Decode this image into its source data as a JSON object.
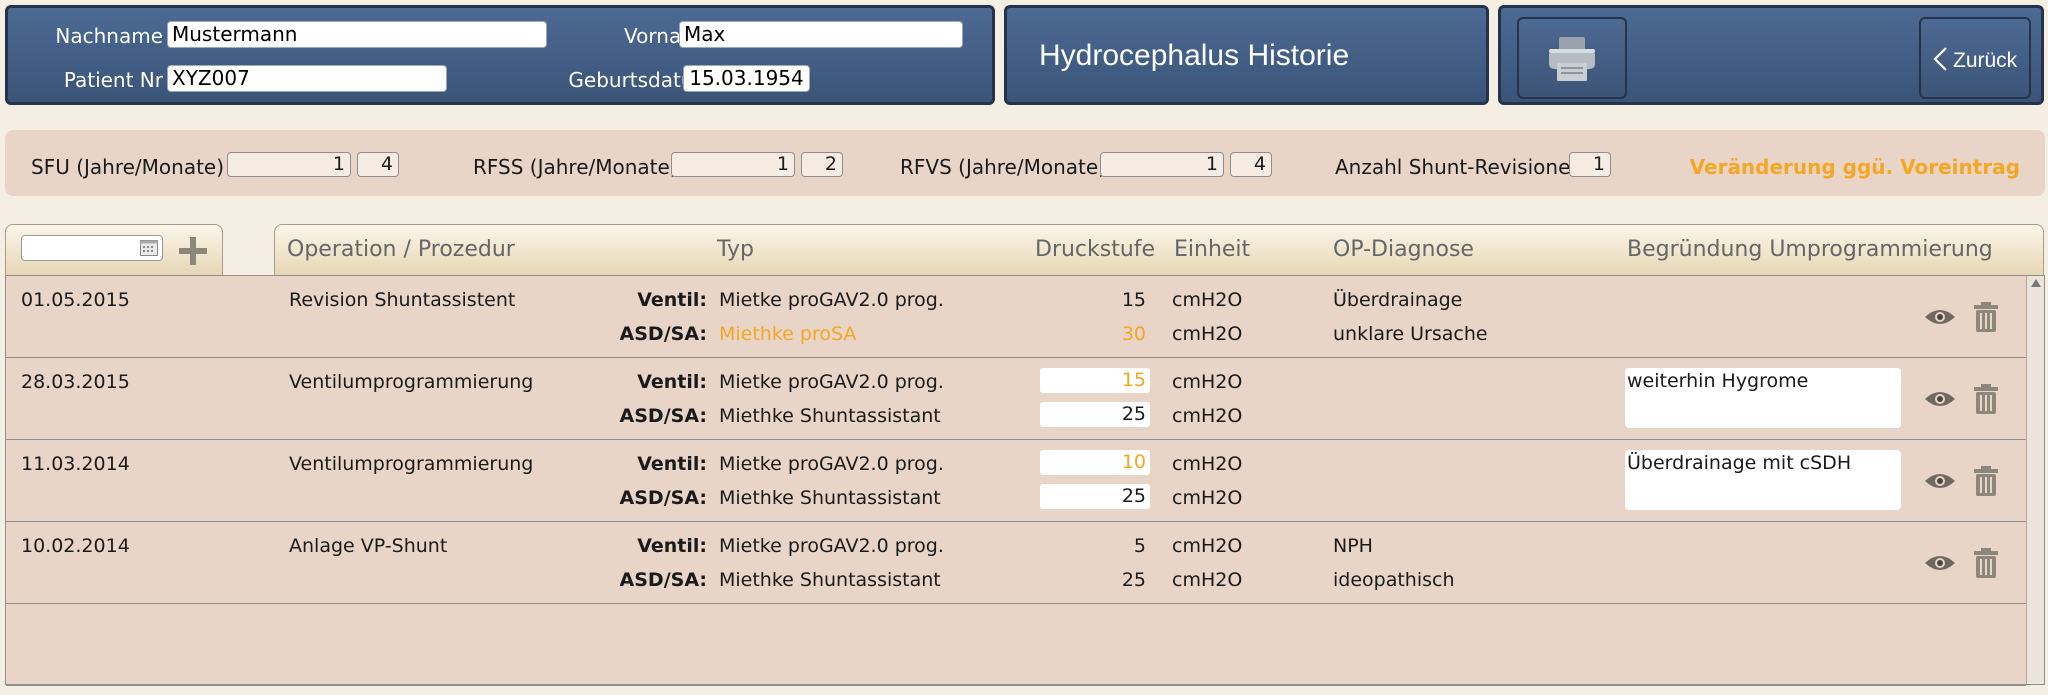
{
  "patient": {
    "nachname_label": "Nachname",
    "nachname": "Mustermann",
    "vorname_label": "Vorname",
    "vorname": "Max",
    "patientnr_label": "Patient Nr",
    "patientnr": "XYZ007",
    "geburtsdatum_label": "Geburtsdatum",
    "geburtsdatum": "15.03.1954"
  },
  "title": "Hydrocephalus Historie",
  "actions": {
    "back_label": "Zurück"
  },
  "summary": {
    "sfu_label": "SFU  (Jahre/Monate)",
    "sfu_years": "1",
    "sfu_months": "4",
    "rfss_label": "RFSS (Jahre/Monate)",
    "rfss_years": "1",
    "rfss_months": "2",
    "rfvs_label": "RFVS (Jahre/Monate)",
    "rfvs_years": "1",
    "rfvs_months": "4",
    "revisions_label": "Anzahl Shunt-Revisionen",
    "revisions": "1",
    "change_hint": "Veränderung ggü. Voreintrag"
  },
  "columns": {
    "operation": "Operation / Prozedur",
    "typ": "Typ",
    "druckstufe": "Druckstufe",
    "einheit": "Einheit",
    "diagnose": "OP-Diagnose",
    "begruendung": "Begründung Umprogrammierung"
  },
  "labels": {
    "ventil": "Ventil:",
    "asd": "ASD/SA:"
  },
  "rows": [
    {
      "date": "01.05.2015",
      "operation": "Revision Shuntassistent",
      "ventil_typ": "Mietke proGAV2.0 prog.",
      "ventil_druck": "15",
      "ventil_einheit": "cmH2O",
      "asd_typ": "Miethke proSA",
      "asd_druck": "30",
      "asd_einheit": "cmH2O",
      "diag1": "Überdrainage",
      "diag2": "unklare Ursache",
      "reason": ""
    },
    {
      "date": "28.03.2015",
      "operation": "Ventilumprogrammierung",
      "ventil_typ": "Mietke proGAV2.0 prog.",
      "ventil_druck": "15",
      "ventil_einheit": "cmH2O",
      "asd_typ": "Miethke Shuntassistant",
      "asd_druck": "25",
      "asd_einheit": "cmH2O",
      "diag1": "",
      "diag2": "",
      "reason": "weiterhin Hygrome"
    },
    {
      "date": "11.03.2014",
      "operation": "Ventilumprogrammierung",
      "ventil_typ": "Mietke proGAV2.0 prog.",
      "ventil_druck": "10",
      "ventil_einheit": "cmH2O",
      "asd_typ": "Miethke Shuntassistant",
      "asd_druck": "25",
      "asd_einheit": "cmH2O",
      "diag1": "",
      "diag2": "",
      "reason": "Überdrainage mit cSDH"
    },
    {
      "date": "10.02.2014",
      "operation": "Anlage VP-Shunt",
      "ventil_typ": "Mietke proGAV2.0 prog.",
      "ventil_druck": "5",
      "ventil_einheit": "cmH2O",
      "asd_typ": "Miethke Shuntassistant",
      "asd_druck": "25",
      "asd_einheit": "cmH2O",
      "diag1": "NPH",
      "diag2": "ideopathisch",
      "reason": ""
    }
  ],
  "colors": {
    "accent": "#f5a623",
    "panel": "#3f5a80"
  },
  "icons": [
    "printer-icon",
    "chevron-left-icon",
    "calendar-icon",
    "plus-icon",
    "eye-icon",
    "trash-icon"
  ]
}
